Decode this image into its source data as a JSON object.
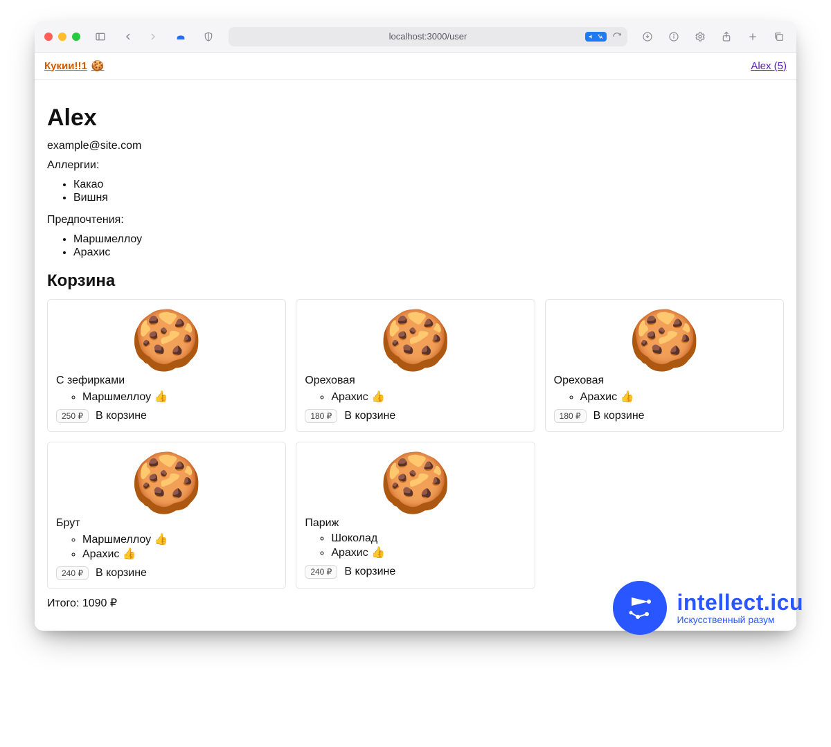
{
  "browser": {
    "url": "localhost:3000/user"
  },
  "appHeader": {
    "brand": "Кукии!!1",
    "brandEmoji": "🍪",
    "userLink": "Alex (5)"
  },
  "user": {
    "name": "Alex",
    "email": "example@site.com",
    "allergiesLabel": "Аллергии:",
    "allergies": [
      "Какао",
      "Вишня"
    ],
    "prefsLabel": "Предпочтения:",
    "prefs": [
      "Маршмеллоу",
      "Арахис"
    ]
  },
  "cart": {
    "heading": "Корзина",
    "inCartLabel": "В корзине",
    "items": [
      {
        "name": "С зефирками",
        "ingredients": [
          {
            "name": "Маршмеллоу",
            "liked": true
          }
        ],
        "price": "250 ₽"
      },
      {
        "name": "Ореховая",
        "ingredients": [
          {
            "name": "Арахис",
            "liked": true
          }
        ],
        "price": "180 ₽"
      },
      {
        "name": "Ореховая",
        "ingredients": [
          {
            "name": "Арахис",
            "liked": true
          }
        ],
        "price": "180 ₽"
      },
      {
        "name": "Брут",
        "ingredients": [
          {
            "name": "Маршмеллоу",
            "liked": true
          },
          {
            "name": "Арахис",
            "liked": true
          }
        ],
        "price": "240 ₽"
      },
      {
        "name": "Париж",
        "ingredients": [
          {
            "name": "Шоколад",
            "liked": false
          },
          {
            "name": "Арахис",
            "liked": true
          }
        ],
        "price": "240 ₽"
      }
    ],
    "totalLabel": "Итого: 1090 ₽"
  },
  "watermark": {
    "title": "intellect.icu",
    "subtitle": "Искусственный разум"
  }
}
